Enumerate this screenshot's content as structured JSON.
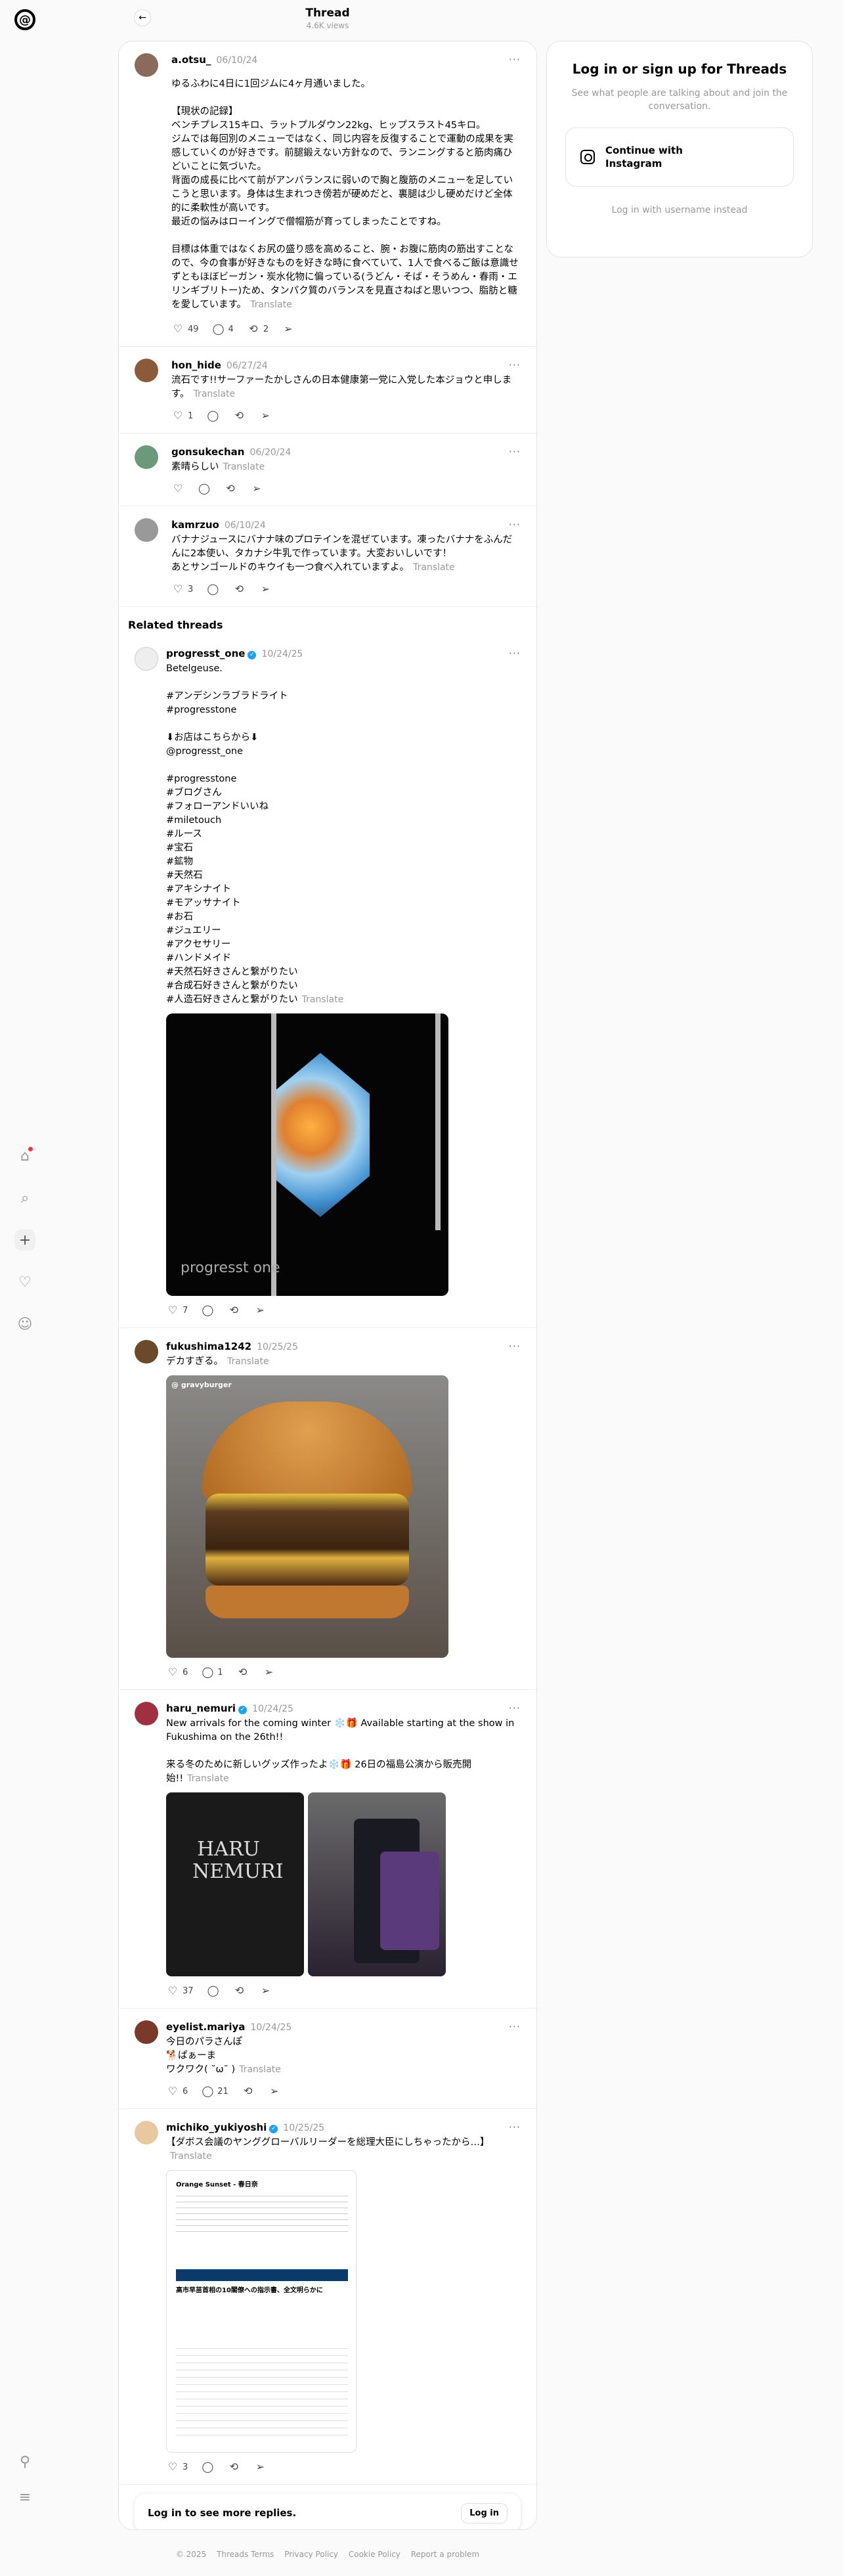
{
  "header": {
    "title": "Thread",
    "views": "4.6K views"
  },
  "posts": [
    {
      "name": "a.otsu_",
      "date": "06/10/24",
      "text": "ゆるふわに4日に1回ジムに4ヶ月通いました。\n\n【現状の記録】\nベンチプレス15キロ、ラットプルダウン22kg、ヒップスラスト45キロ。\nジムでは毎回別のメニューではなく、同じ内容を反復することで運動の成果を実感していくのが好きです。前腿鍛えない方針なので、ランニングすると筋肉痛ひどいことに気づいた。\n背面の成長に比べて前がアンバランスに弱いので胸と腹筋のメニューを足していこうと思います。身体は生まれつき傍若が硬めだと、裏腿は少し硬めだけど全体的に柔軟性が高いです。\n最近の悩みはローイングで僧帽筋が育ってしまったことですね。\n\n目標は体重ではなくお尻の盛り感を高めること、腕・お腹に筋肉の筋出すことなので、今の食事が好きなものを好きな時に食べていて、1人で食べるご飯は意識せずともほぼビーガン・炭水化物に偏っている(うどん・そば・そうめん・春雨・エリンギブリトー)ため、タンパク質のバランスを見直さねばと思いつつ、脂肪と糖を愛しています。",
      "translate": "Translate",
      "likes": "49",
      "replies": "4",
      "reposts": "2"
    },
    {
      "name": "hon_hide",
      "date": "06/27/24",
      "text": "流石です!!サーファーたかしさんの日本健康第一党に入党した本ジョウと申します。",
      "translate": "Translate",
      "likes": "1"
    },
    {
      "name": "gonsukechan",
      "date": "06/20/24",
      "text": "素晴らしい",
      "translate": "Translate"
    },
    {
      "name": "kamrzuo",
      "date": "06/10/24",
      "text": "バナナジュースにバナナ味のプロテインを混ぜています。凍ったバナナをふんだんに2本使い、タカナシ牛乳で作っています。大変おいしいです！\nあとサンゴールドのキウイも一つ食べ入れていますよ。",
      "translate": "Translate",
      "likes": "3"
    }
  ],
  "related_title": "Related threads",
  "related": [
    {
      "name": "progresst_one",
      "date": "10/24/25",
      "text": "Betelgeuse.\n\n#アンデシンラブラドライト\n#progresstone\n\n⬇お店はこちらから⬇\n@progresst_one\n\n#progresstone\n#ブログさん\n#フォローアンドいいね\n#miletouch\n#ルース\n#宝石\n#鉱物\n#天然石\n#アキシナイト\n#モアッサナイト\n#お石\n#ジュエリー\n#アクセサリー\n#ハンドメイド\n#天然石好きさんと繋がりたい\n#合成石好きさんと繋がりたい\n#人造石好きさんと繋がりたい",
      "translate": "Translate",
      "image_watermark": "progresst one",
      "likes": "7"
    },
    {
      "name": "fukushima1242",
      "date": "10/25/25",
      "text": "デカすぎる。",
      "translate": "Translate",
      "image_tag": "@ gravyburger",
      "likes": "6",
      "replies": "1"
    },
    {
      "name": "haru_nemuri",
      "date": "10/24/25",
      "text": "New arrivals for the coming winter ❄️🎁 Available starting at the show in Fukushima on the 26th!!\n\n来る冬のために新しいグッズ作ったよ❄️🎁 26日の福島公演から販売開始!!",
      "translate": "Translate",
      "shirt_text": "HARU NEMURI",
      "likes": "37"
    },
    {
      "name": "eyelist.mariya",
      "date": "10/24/25",
      "text": "今日のパラさんぽ\n🐕ぱぁーま\nワクワク( ˘ω˘ )",
      "translate": "Translate",
      "likes": "6",
      "replies": "21"
    },
    {
      "name": "michiko_yukiyoshi",
      "date": "10/25/25",
      "text": "【ダボス会議のヤンググローバルリーダーを総理大臣にしちゃったから…】",
      "translate": "Translate",
      "news_source": "Orange Sunset - 春日奈",
      "news_headline": "高市早苗首相の10閣僚への指示書、全文明らかに",
      "likes": "3"
    }
  ],
  "login_bar": {
    "text": "Log in to see more replies.",
    "button": "Log in"
  },
  "side": {
    "title": "Log in or sign up for Threads",
    "sub": "See what people are talking about and join the conversation.",
    "ig_button": "Continue with Instagram",
    "username": "Log in with username instead"
  },
  "footer": [
    "© 2025",
    "Threads Terms",
    "Privacy Policy",
    "Cookie Policy",
    "Report a problem"
  ],
  "icons": [
    "threads-logo-icon",
    "home-icon",
    "search-icon",
    "plus-icon",
    "heart-icon",
    "profile-icon",
    "pin-icon",
    "menu-icon"
  ]
}
